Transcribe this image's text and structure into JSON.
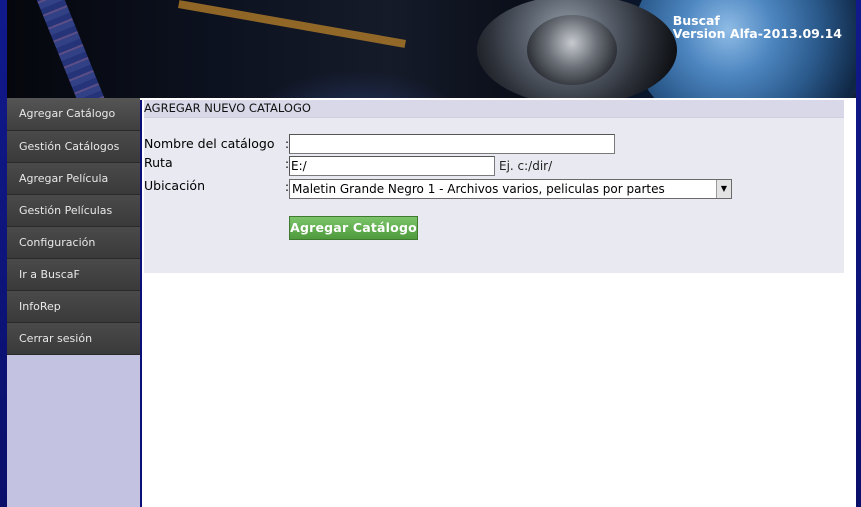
{
  "banner": {
    "app_name": "Buscaf",
    "version": "Version Alfa-2013.09.14"
  },
  "sidebar": {
    "items": [
      {
        "label": "Agregar Catálogo"
      },
      {
        "label": "Gestión Catálogos"
      },
      {
        "label": "Agregar Película"
      },
      {
        "label": "Gestión Películas"
      },
      {
        "label": "Configuración"
      },
      {
        "label": "Ir a BuscaF"
      },
      {
        "label": "InfoRep"
      },
      {
        "label": "Cerrar sesión"
      }
    ]
  },
  "form": {
    "title": "AGREGAR NUEVO CATALOGO",
    "nombre_label": "Nombre del catálogo",
    "nombre_value": "",
    "ruta_label": "Ruta",
    "ruta_value": "E:/",
    "ruta_hint": "Ej. c:/dir/",
    "ubicacion_label": "Ubicación",
    "ubicacion_selected": "Maletin Grande Negro 1 - Archivos varios, peliculas por partes",
    "colon": ":",
    "submit_label": "Agregar Catálogo"
  },
  "colors": {
    "page_background": "#0a0f7a",
    "sidebar_background": "#c3c3e1",
    "menu_item_background": "#3f3f3f",
    "panel_background": "#e9e9f1",
    "button_green": "#5aa845"
  }
}
